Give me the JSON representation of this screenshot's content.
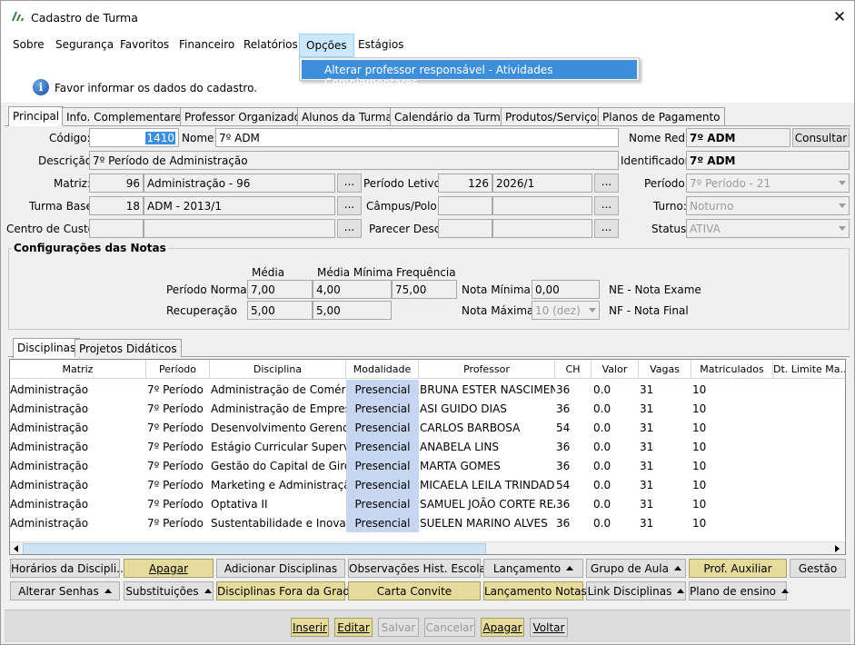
{
  "window": {
    "title": "Cadastro de Turma"
  },
  "menu": {
    "items": [
      "Sobre",
      "Segurança",
      "Favoritos",
      "Financeiro",
      "Relatórios",
      "Opções",
      "Estágios"
    ],
    "active": "Opções",
    "dropdown_item": "Alterar professor responsável - Atividades Complementares"
  },
  "info": {
    "message": "Favor informar os dados do cadastro."
  },
  "main_tabs": [
    "Principal",
    "Info. Complementares",
    "Professor Organizador",
    "Alunos da Turma",
    "Calendário da Turma",
    "Produtos/Serviços",
    "Planos de Pagamento"
  ],
  "form": {
    "codigo_label": "Código:",
    "codigo": "1410",
    "nome_label": "Nome:",
    "nome": "7º ADM",
    "nome_red_label": "Nome Red.:",
    "nome_red": "7º ADM",
    "consultar": "Consultar",
    "descricao_label": "Descrição:",
    "descricao": "7º Período de Administração",
    "identificador_label": "Identificador:",
    "identificador": "7º ADM",
    "matriz_label": "Matriz:",
    "matriz_cod": "96",
    "matriz": "Administração - 96",
    "periodo_letivo_label": "Período Letivo:",
    "periodo_letivo_cod": "126",
    "periodo_letivo": "2026/1",
    "periodo_label": "Período:",
    "periodo": "7º Período - 21",
    "turma_base_label": "Turma Base:",
    "turma_base_cod": "18",
    "turma_base": "ADM - 2013/1",
    "campus_label": "Câmpus/Polo:",
    "turno_label": "Turno:",
    "turno": "Noturno",
    "centro_custo_label": "Centro de Custo:",
    "parecer_label": "Parecer Desc.:",
    "status_label": "Status:",
    "status": "ATIVA",
    "dots": "..."
  },
  "notas": {
    "title": "Configurações das Notas",
    "col_media": "Média",
    "col_media_min": "Média Mínima",
    "col_freq": "Frequência",
    "normal_label": "Período Normal",
    "normal_media": "7,00",
    "normal_media_min": "4,00",
    "normal_freq": "75,00",
    "rec_label": "Recuperação",
    "rec_media": "5,00",
    "rec_media_min": "5,00",
    "nota_min_label": "Nota Mínima",
    "nota_min": "0,00",
    "nota_max_label": "Nota Máxima",
    "nota_max": "10 (dez)",
    "ne": "NE - Nota Exame",
    "nf": "NF - Nota Final"
  },
  "sub_tabs": [
    "Disciplinas",
    "Projetos Didáticos"
  ],
  "grid": {
    "columns": [
      "Matriz",
      "Período",
      "Disciplina",
      "Modalidade",
      "Professor",
      "CH",
      "Valor",
      "Vagas",
      "Matriculados",
      "Dt. Limite Ma..."
    ],
    "rows": [
      [
        "Administração",
        "7º Período",
        "Administração de Comércio",
        "Presencial",
        "BRUNA ESTER NASCIMEN...",
        "36",
        "0.0",
        "31",
        "10",
        ""
      ],
      [
        "Administração",
        "7º Período",
        "Administração de Empresas",
        "Presencial",
        "ASI GUIDO DIAS",
        "36",
        "0.0",
        "31",
        "10",
        ""
      ],
      [
        "Administração",
        "7º Período",
        "Desenvolvimento Gerencial e",
        "Presencial",
        "CARLOS BARBOSA",
        "54",
        "0.0",
        "31",
        "10",
        ""
      ],
      [
        "Administração",
        "7º Período",
        "Estágio Curricular Supervisio",
        "Presencial",
        "ANABELA LINS",
        "36",
        "0.0",
        "31",
        "10",
        ""
      ],
      [
        "Administração",
        "7º Período",
        "Gestão do Capital de Giro",
        "Presencial",
        "MARTA GOMES",
        "36",
        "0.0",
        "31",
        "10",
        ""
      ],
      [
        "Administração",
        "7º Período",
        "Marketing e Administração E",
        "Presencial",
        "MICAELA LEILA TRINDADE",
        "54",
        "0.0",
        "31",
        "10",
        ""
      ],
      [
        "Administração",
        "7º Período",
        "Optativa II",
        "Presencial",
        "SAMUEL JOÃO CORTE REAL",
        "36",
        "0.0",
        "31",
        "10",
        ""
      ],
      [
        "Administração",
        "7º Período",
        "Sustentabilidade e Inovação",
        "Presencial",
        "SUELEN MARINO ALVES",
        "36",
        "0.0",
        "31",
        "10",
        ""
      ]
    ]
  },
  "action_buttons_row1": [
    "Horários da Discipli...",
    "Apagar",
    "Adicionar Disciplinas",
    "Observações Hist. Escolar",
    "Lançamento",
    "Grupo de Aula",
    "Prof. Auxiliar",
    "Gestão"
  ],
  "action_buttons_row2": [
    "Alterar Senhas",
    "Substituições",
    "Disciplinas Fora da Grade",
    "Carta Convite",
    "Lançamento Notas",
    "Link Disciplinas",
    "Plano de ensino"
  ],
  "bottom_buttons": [
    "Inserir",
    "Editar",
    "Salvar",
    "Cancelar",
    "Apagar",
    "Voltar"
  ],
  "colors": {
    "accent": "#3d8fdc",
    "highlight_button": "#e5dc9b",
    "modalidade_cell": "#c6d6f0"
  }
}
